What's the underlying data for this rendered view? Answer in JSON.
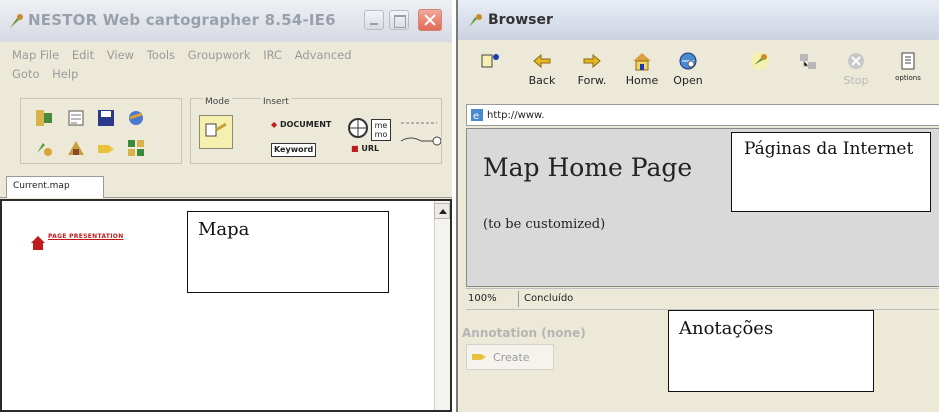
{
  "left_window": {
    "title": "NESTOR Web cartographer 8.54-IE6",
    "menu": [
      "Map File",
      "Edit",
      "View",
      "Tools",
      "Groupwork",
      "IRC",
      "Advanced",
      "Goto",
      "Help"
    ],
    "mode_label": "Mode",
    "insert_label": "Insert",
    "insert_document": "DOCUMENT",
    "insert_keyword": "Keyword",
    "insert_url": "URL",
    "insert_memo": "me mo",
    "tab_label": "Current.map",
    "map_node_text": "PAGE PRESENTATION"
  },
  "right_window": {
    "title": "Browser",
    "nav": {
      "back": "Back",
      "forward": "Forw.",
      "home": "Home",
      "open": "Open",
      "stop": "Stop",
      "options": "options"
    },
    "address": "http://www.",
    "page_title": "Map Home Page",
    "page_subtitle": "(to be customized)",
    "zoom": "100%",
    "status": "Concluído",
    "annotation_header": "Annotation (none)",
    "annotation_create": "Create"
  },
  "callouts": {
    "mapa": "Mapa",
    "paginas": "Páginas da Internet",
    "anotacoes": "Anotações"
  },
  "colors": {
    "chrome": "#ece9d8",
    "close_button": "#e06a55",
    "map_link": "#c01a1a",
    "page_bg": "#d9d9d9"
  }
}
